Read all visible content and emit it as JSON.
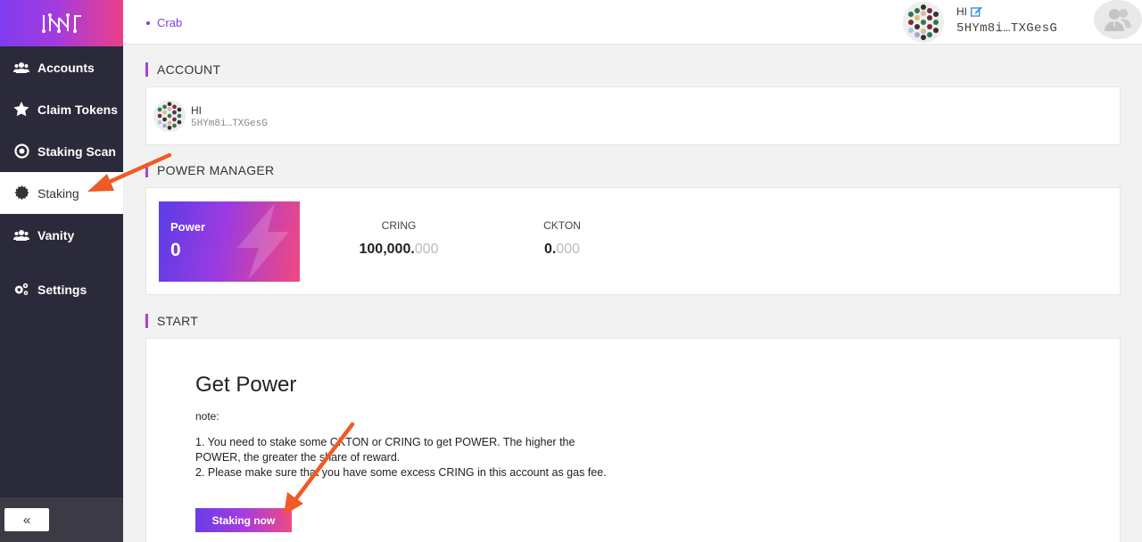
{
  "sidebar": {
    "items": [
      {
        "label": "Accounts",
        "icon": "users-icon"
      },
      {
        "label": "Claim Tokens",
        "icon": "star-icon"
      },
      {
        "label": "Staking Scan",
        "icon": "target-icon"
      },
      {
        "label": "Staking",
        "icon": "gear-badge-icon"
      },
      {
        "label": "Vanity",
        "icon": "users-icon"
      },
      {
        "label": "Settings",
        "icon": "gears-icon"
      }
    ],
    "collapse_label": "«"
  },
  "header": {
    "network": "Crab",
    "account_name": "HI",
    "account_address": "5HYm8i…TXGesG"
  },
  "account_section": {
    "title": "ACCOUNT",
    "name": "HI",
    "address": "5HYm8i…TXGesG"
  },
  "power_section": {
    "title": "POWER MANAGER",
    "power_label": "Power",
    "power_value": "0",
    "cring_label": "CRING",
    "cring_int": "100,000.",
    "cring_dec": "000",
    "ckton_label": "CKTON",
    "ckton_int": "0.",
    "ckton_dec": "000"
  },
  "start_section": {
    "title": "START",
    "heading": "Get Power",
    "note_label": "note:",
    "note_line1": "1. You need to stake some CKTON or CRING to get POWER. The higher the POWER, the greater the share of reward.",
    "note_line2": "2. Please make sure that you have some excess CRING in this account as gas fee.",
    "button_label": "Staking now"
  },
  "colors": {
    "accent_purple": "#7b3ce8",
    "accent_pink": "#ee4a85",
    "sidebar_bg": "#2b2a3a",
    "annotation_arrow": "#f05a24"
  }
}
